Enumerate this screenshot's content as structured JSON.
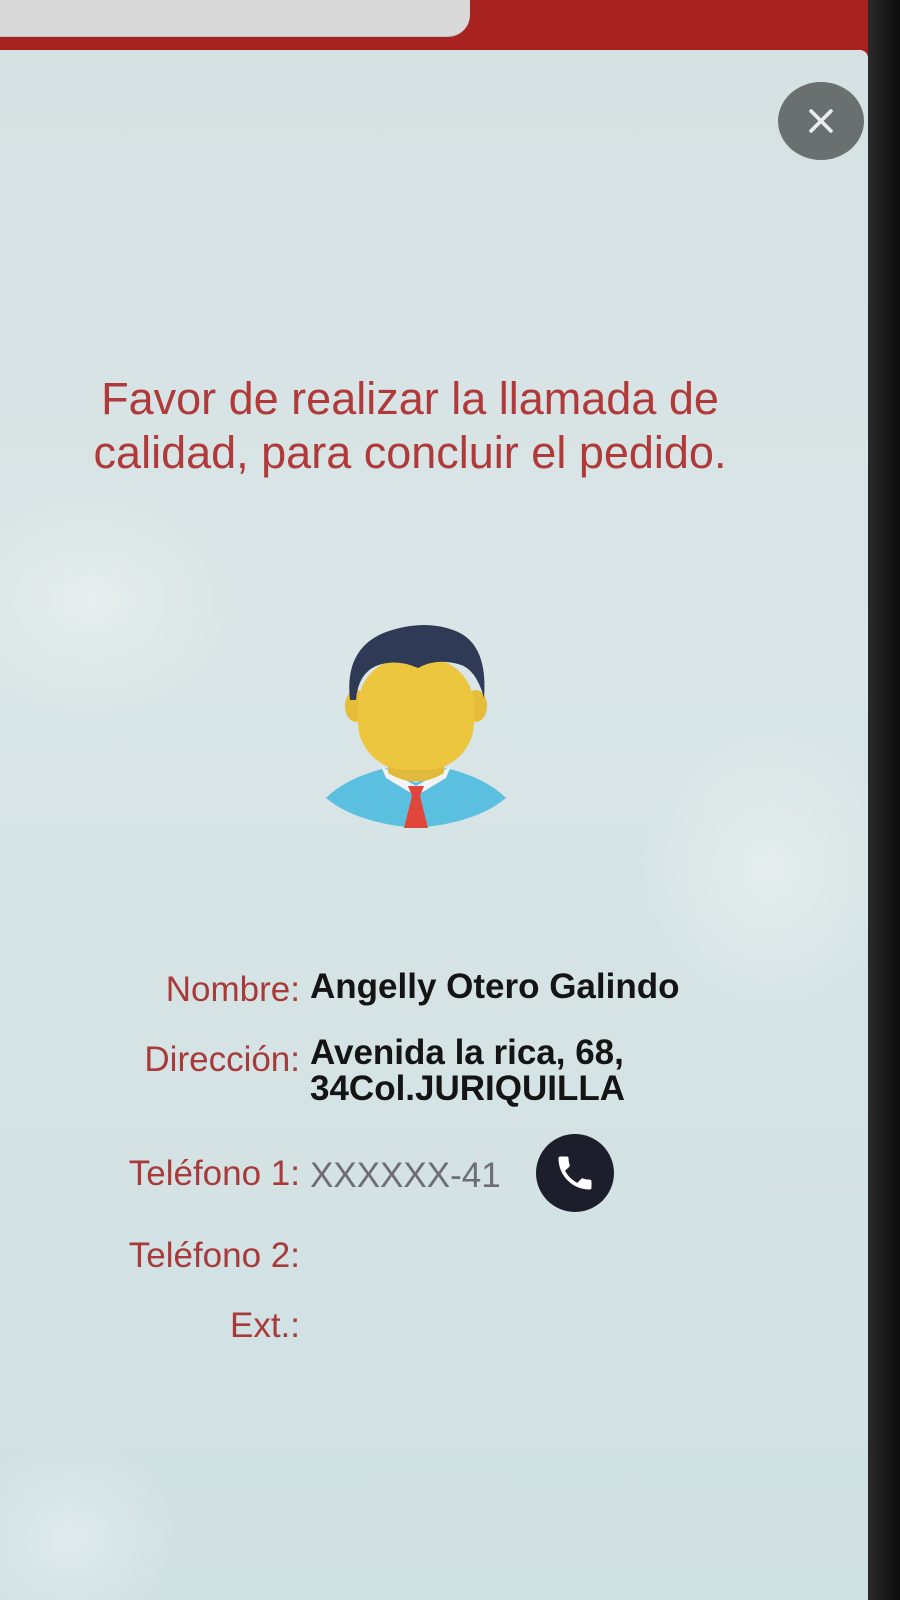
{
  "dialog": {
    "close_icon": "close-icon",
    "message": "Favor de realizar la llamada de calidad, para concluir el pedido.",
    "avatar_icon": "person-avatar-icon"
  },
  "customer": {
    "name_label": "Nombre:",
    "name_value": "Angelly Otero Galindo",
    "address_label": "Dirección:",
    "address_line1": "Avenida la rica, 68,",
    "address_line2": "34Col.JURIQUILLA",
    "phone1_label": "Teléfono 1:",
    "phone1_value": "XXXXXX-41",
    "phone2_label": "Teléfono 2:",
    "phone2_value": "",
    "ext_label": "Ext.:",
    "ext_value": ""
  },
  "actions": {
    "call_icon": "phone-icon"
  },
  "colors": {
    "accent_red": "#a8231f",
    "label_red": "#a83a3a",
    "background": "#d5e1e2",
    "call_button": "#1c1f2b"
  }
}
